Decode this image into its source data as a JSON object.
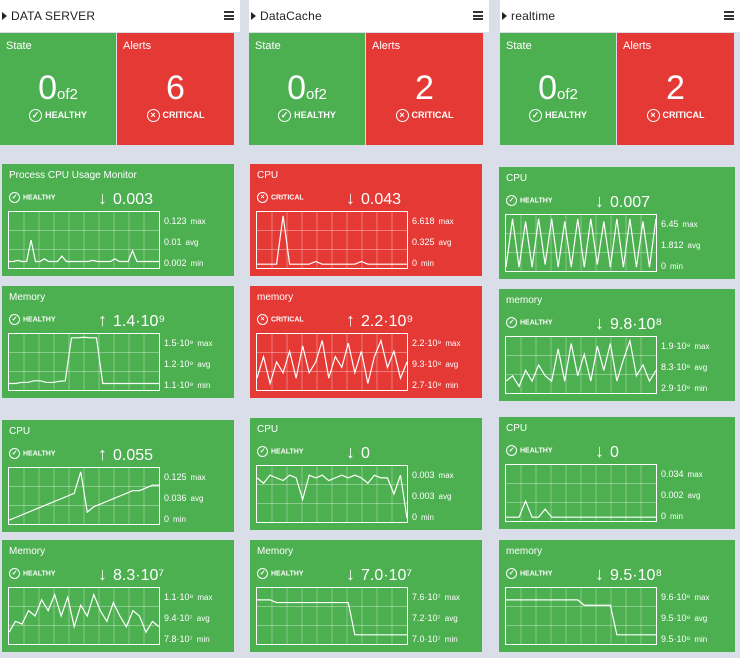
{
  "columns": [
    {
      "title": "DATA SERVER",
      "state_label": "State",
      "state_value": "0",
      "state_of": "of2",
      "state_status": "HEALTHY",
      "alerts_label": "Alerts",
      "alerts_value": "6",
      "alerts_status": "CRITICAL",
      "tiles": [
        {
          "name": "Process CPU Usage Monitor",
          "status": "HEALTHY",
          "trend": "down",
          "value": "0.003",
          "max": "0.123",
          "avg": "0.01",
          "min": "0.002",
          "state": "ok",
          "max_label": "max",
          "avg_label": "avg",
          "min_label": "min",
          "series": [
            0.1,
            0.1,
            0.12,
            0.1,
            0.1,
            0.5,
            0.1,
            0.1,
            0.15,
            0.1,
            0.1,
            0.1,
            0.2,
            0.1,
            0.1,
            0.1,
            0.1,
            0.1,
            0.1,
            0.12,
            0.1,
            0.1,
            0.1,
            0.1,
            0.15,
            0.1,
            0.1,
            0.1,
            0.3,
            0.1,
            0.1,
            0.1,
            0.1,
            0.1,
            0.1
          ]
        },
        {
          "name": "Memory",
          "status": "HEALTHY",
          "trend": "up",
          "value": "1.4·10⁹",
          "max": "1.5·10⁹",
          "avg": "1.2·10⁹",
          "min": "1.1·10⁹",
          "state": "ok",
          "max_label": "max",
          "avg_label": "avg",
          "min_label": "min",
          "series": [
            0.1,
            0.1,
            0.12,
            0.12,
            0.15,
            0.15,
            0.12,
            0.12,
            0.14,
            0.15,
            0.95,
            0.95,
            0.96,
            0.95,
            0.95,
            0.1,
            0.1,
            0.1,
            0.1,
            0.1,
            0.1,
            0.1,
            0.1,
            0.1,
            0.1
          ]
        },
        {
          "name": "CPU",
          "status": "HEALTHY",
          "trend": "up",
          "value": "0.055",
          "max": "0.125",
          "avg": "0.036",
          "min": "0",
          "state": "ok",
          "max_label": "max",
          "avg_label": "avg",
          "min_label": "min",
          "series": [
            0.05,
            0.1,
            0.15,
            0.2,
            0.25,
            0.3,
            0.35,
            0.4,
            0.45,
            0.5,
            0.55,
            0.95,
            0.2,
            0.3,
            0.35,
            0.4,
            0.45,
            0.5,
            0.55,
            0.6,
            0.6,
            0.65,
            0.7,
            0.7
          ]
        },
        {
          "name": "Memory",
          "status": "HEALTHY",
          "trend": "down",
          "value": "8.3·10⁷",
          "max": "1.1·10⁸",
          "avg": "9.4·10⁷",
          "min": "7.8·10⁷",
          "state": "ok",
          "max_label": "max",
          "avg_label": "avg",
          "min_label": "min",
          "series": [
            0.2,
            0.4,
            0.35,
            0.6,
            0.5,
            0.8,
            0.6,
            0.9,
            0.5,
            0.85,
            0.3,
            0.7,
            0.5,
            0.9,
            0.6,
            0.4,
            0.75,
            0.5,
            0.3,
            0.6,
            0.5,
            0.2,
            0.4,
            0.3
          ]
        }
      ]
    },
    {
      "title": "DataCache",
      "state_label": "State",
      "state_value": "0",
      "state_of": "of2",
      "state_status": "HEALTHY",
      "alerts_label": "Alerts",
      "alerts_value": "2",
      "alerts_status": "CRITICAL",
      "tiles": [
        {
          "name": "CPU",
          "status": "CRITICAL",
          "trend": "down",
          "value": "0.043",
          "max": "6.618",
          "avg": "0.325",
          "min": "0",
          "state": "crit",
          "max_label": "max",
          "avg_label": "avg",
          "min_label": "min",
          "series": [
            0.05,
            0.05,
            0.05,
            0.05,
            0.95,
            0.05,
            0.05,
            0.05,
            0.05,
            0.1,
            0.05,
            0.05,
            0.05,
            0.05,
            0.05,
            0.05,
            0.1,
            0.05,
            0.05,
            0.05,
            0.05,
            0.05,
            0.05,
            0.05
          ]
        },
        {
          "name": "memory",
          "status": "CRITICAL",
          "trend": "up",
          "value": "2.2·10⁹",
          "max": "2.2·10⁹",
          "avg": "9.3·10⁸",
          "min": "2.7·10⁸",
          "state": "crit",
          "max_label": "max",
          "avg_label": "avg",
          "min_label": "min",
          "series": [
            0.2,
            0.6,
            0.1,
            0.5,
            0.3,
            0.7,
            0.2,
            0.8,
            0.3,
            0.5,
            0.9,
            0.2,
            0.6,
            0.4,
            0.85,
            0.3,
            0.7,
            0.1,
            0.6,
            0.9,
            0.4,
            0.7,
            0.2,
            0.5
          ]
        },
        {
          "name": "CPU",
          "status": "HEALTHY",
          "trend": "down",
          "value": "0",
          "max": "0.003",
          "avg": "0.003",
          "min": "0",
          "state": "ok",
          "max_label": "max",
          "avg_label": "avg",
          "min_label": "min",
          "series": [
            0.8,
            0.7,
            0.85,
            0.8,
            0.75,
            0.85,
            0.8,
            0.4,
            0.85,
            0.8,
            0.85,
            0.75,
            0.8,
            0.85,
            0.8,
            0.85,
            0.8,
            0.7,
            0.85,
            0.8,
            0.8,
            0.5,
            0.85,
            0.05
          ]
        },
        {
          "name": "Memory",
          "status": "HEALTHY",
          "trend": "down",
          "value": "7.0·10⁷",
          "max": "7.6·10⁷",
          "avg": "7.2·10⁷",
          "min": "7.0·10⁷",
          "state": "ok",
          "max_label": "max",
          "avg_label": "avg",
          "min_label": "min",
          "series": [
            0.8,
            0.8,
            0.8,
            0.75,
            0.75,
            0.75,
            0.75,
            0.75,
            0.75,
            0.75,
            0.75,
            0.75,
            0.75,
            0.75,
            0.75,
            0.15,
            0.15,
            0.15,
            0.15,
            0.15,
            0.15,
            0.15,
            0.15,
            0.15
          ]
        }
      ]
    },
    {
      "title": "realtime",
      "state_label": "State",
      "state_value": "0",
      "state_of": "of2",
      "state_status": "HEALTHY",
      "alerts_label": "Alerts",
      "alerts_value": "2",
      "alerts_status": "CRITICAL",
      "tiles": [
        {
          "name": "CPU",
          "status": "HEALTHY",
          "trend": "down",
          "value": "0.007",
          "max": "6.45",
          "avg": "1.812",
          "min": "0",
          "state": "ok",
          "max_label": "max",
          "avg_label": "avg",
          "min_label": "min",
          "series": [
            0.05,
            0.95,
            0.05,
            0.9,
            0.05,
            0.95,
            0.1,
            0.95,
            0.05,
            0.9,
            0.05,
            0.95,
            0.05,
            0.95,
            0.1,
            0.9,
            0.05,
            0.95,
            0.05,
            0.95,
            0.05,
            0.9,
            0.05,
            0.95
          ]
        },
        {
          "name": "memory",
          "status": "HEALTHY",
          "trend": "down",
          "value": "9.8·10⁸",
          "max": "1.9·10⁹",
          "avg": "8.3·10⁸",
          "min": "2.9·10⁸",
          "state": "ok",
          "max_label": "max",
          "avg_label": "avg",
          "min_label": "min",
          "series": [
            0.2,
            0.3,
            0.1,
            0.4,
            0.2,
            0.5,
            0.3,
            0.2,
            0.8,
            0.2,
            0.9,
            0.3,
            0.7,
            0.2,
            0.85,
            0.4,
            0.9,
            0.2,
            0.6,
            0.95,
            0.3,
            0.5,
            0.2,
            0.4
          ]
        },
        {
          "name": "CPU",
          "status": "HEALTHY",
          "trend": "down",
          "value": "0",
          "max": "0.034",
          "avg": "0.002",
          "min": "0",
          "state": "ok",
          "max_label": "max",
          "avg_label": "avg",
          "min_label": "min",
          "series": [
            0.05,
            0.05,
            0.05,
            0.35,
            0.05,
            0.05,
            0.2,
            0.05,
            0.05,
            0.05,
            0.05,
            0.05,
            0.05,
            0.05,
            0.05,
            0.05,
            0.05,
            0.05,
            0.05,
            0.05,
            0.05,
            0.05,
            0.05,
            0.05
          ]
        },
        {
          "name": "memory",
          "status": "HEALTHY",
          "trend": "down",
          "value": "9.5·10⁸",
          "max": "9.6·10⁸",
          "avg": "9.5·10⁸",
          "min": "9.5·10⁸",
          "state": "ok",
          "max_label": "max",
          "avg_label": "avg",
          "min_label": "min",
          "series": [
            0.8,
            0.8,
            0.8,
            0.8,
            0.8,
            0.8,
            0.8,
            0.8,
            0.8,
            0.8,
            0.8,
            0.8,
            0.7,
            0.7,
            0.7,
            0.7,
            0.7,
            0.15,
            0.15,
            0.15,
            0.15,
            0.15,
            0.15,
            0.15
          ]
        }
      ]
    }
  ],
  "colors": {
    "healthy": "#4caf50",
    "critical": "#e53935",
    "background": "#d9dee9"
  },
  "icons": {
    "healthy": "check-circle-icon",
    "critical": "x-circle-icon",
    "up": "arrow-up-icon",
    "down": "arrow-down-icon",
    "menu": "hamburger-menu-icon",
    "expand": "triangle-right-icon"
  }
}
